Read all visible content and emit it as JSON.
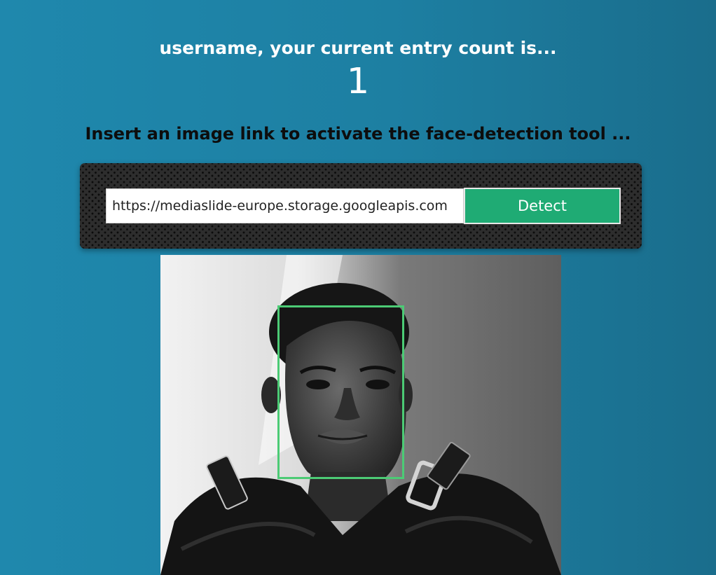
{
  "header": {
    "greeting": "username, your current entry count is...",
    "entry_count": "1"
  },
  "form": {
    "instruction": "Insert an image link to activate the face-detection tool ...",
    "url_value": "https://mediaslide-europe.storage.googleapis.com",
    "detect_label": "Detect"
  },
  "result": {
    "face_box_color": "#4ccb75",
    "image_kind": "black-and-white portrait photo"
  },
  "colors": {
    "background": "#1f88ad",
    "button": "#1fab74",
    "panel": "#2d2d2d"
  }
}
